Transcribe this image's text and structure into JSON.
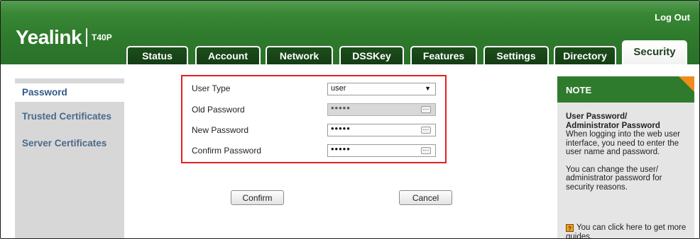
{
  "header": {
    "logo": "Yealink",
    "model": "T40P",
    "logout": "Log Out"
  },
  "tabs": [
    {
      "label": "Status"
    },
    {
      "label": "Account"
    },
    {
      "label": "Network"
    },
    {
      "label": "DSSKey"
    },
    {
      "label": "Features"
    },
    {
      "label": "Settings"
    },
    {
      "label": "Directory"
    },
    {
      "label": "Security",
      "active": true
    }
  ],
  "sidebar": {
    "items": [
      {
        "label": "Password",
        "active": true
      },
      {
        "label": "Trusted Certificates"
      },
      {
        "label": "Server Certificates"
      }
    ]
  },
  "form": {
    "user_type_label": "User Type",
    "user_type_value": "user",
    "old_password_label": "Old Password",
    "old_password_value": "•••••",
    "new_password_label": "New Password",
    "new_password_value": "•••••",
    "confirm_password_label": "Confirm Password",
    "confirm_password_value": "•••••",
    "confirm_button": "Confirm",
    "cancel_button": "Cancel"
  },
  "note": {
    "title": "NOTE",
    "heading1": "User Password/",
    "heading2": "Administrator Password",
    "text1": "When logging into the web user interface, you need to enter the user name and password.",
    "text2": "You can change the user/ administrator password for security reasons.",
    "help_text": "You can click here to get more guides."
  },
  "colors": {
    "brand_green": "#2f7b2d",
    "note_corner": "#f08c1e",
    "highlight_box": "#e02020"
  }
}
